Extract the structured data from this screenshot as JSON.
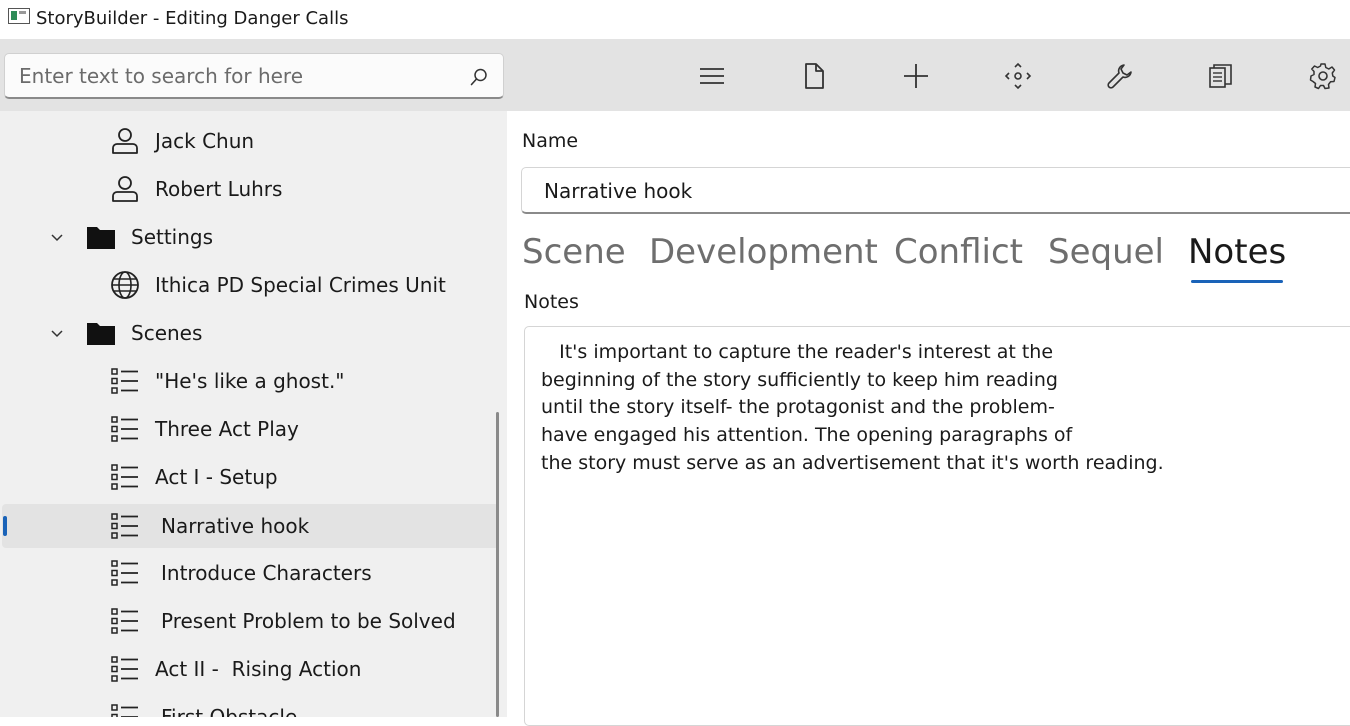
{
  "window": {
    "title": "StoryBuilder - Editing Danger Calls"
  },
  "search": {
    "placeholder": "Enter text to search for here"
  },
  "toolbar": {
    "buttons": [
      {
        "icon": "hamburger-menu-icon"
      },
      {
        "icon": "document-icon"
      },
      {
        "icon": "plus-icon"
      },
      {
        "icon": "move-arrows-icon"
      },
      {
        "icon": "wrench-icon"
      },
      {
        "icon": "copy-documents-icon"
      },
      {
        "icon": "gear-icon"
      }
    ]
  },
  "tree": {
    "items": [
      {
        "label": "Jack Chun",
        "icon": "person-icon"
      },
      {
        "label": "Robert Luhrs",
        "icon": "person-icon"
      },
      {
        "label": "Settings",
        "icon": "folder-icon",
        "expanded": true
      },
      {
        "label": "Ithica PD Special Crimes Unit",
        "icon": "globe-icon"
      },
      {
        "label": "Scenes",
        "icon": "folder-icon",
        "expanded": true
      },
      {
        "label": "\"He's like a ghost.\"",
        "icon": "list-icon"
      },
      {
        "label": "Three Act Play",
        "icon": "list-icon"
      },
      {
        "label": "Act I - Setup",
        "icon": "list-icon"
      },
      {
        "label": "Narrative hook",
        "icon": "list-icon",
        "selected": true
      },
      {
        "label": "Introduce Characters",
        "icon": "list-icon"
      },
      {
        "label": "Present Problem to be Solved",
        "icon": "list-icon"
      },
      {
        "label": "Act II -  Rising Action",
        "icon": "list-icon"
      },
      {
        "label": "First Obstacle",
        "icon": "list-icon"
      }
    ]
  },
  "editor": {
    "name_label": "Name",
    "name_value": "Narrative hook",
    "tabs": [
      {
        "label": "Scene"
      },
      {
        "label": "Development"
      },
      {
        "label": "Conflict"
      },
      {
        "label": "Sequel"
      },
      {
        "label": "Notes",
        "active": true
      }
    ],
    "notes_label": "Notes",
    "notes_text": "   It's important to capture the reader's interest at the\nbeginning of the story sufficiently to keep him reading\nuntil the story itself- the protagonist and the problem-\nhave engaged his attention. The opening paragraphs of\nthe story must serve as an advertisement that it's worth reading."
  },
  "colors": {
    "accent": "#1a63b8",
    "toolbar_bg": "#e3e3e3",
    "sidebar_bg": "#f0f0f0"
  }
}
